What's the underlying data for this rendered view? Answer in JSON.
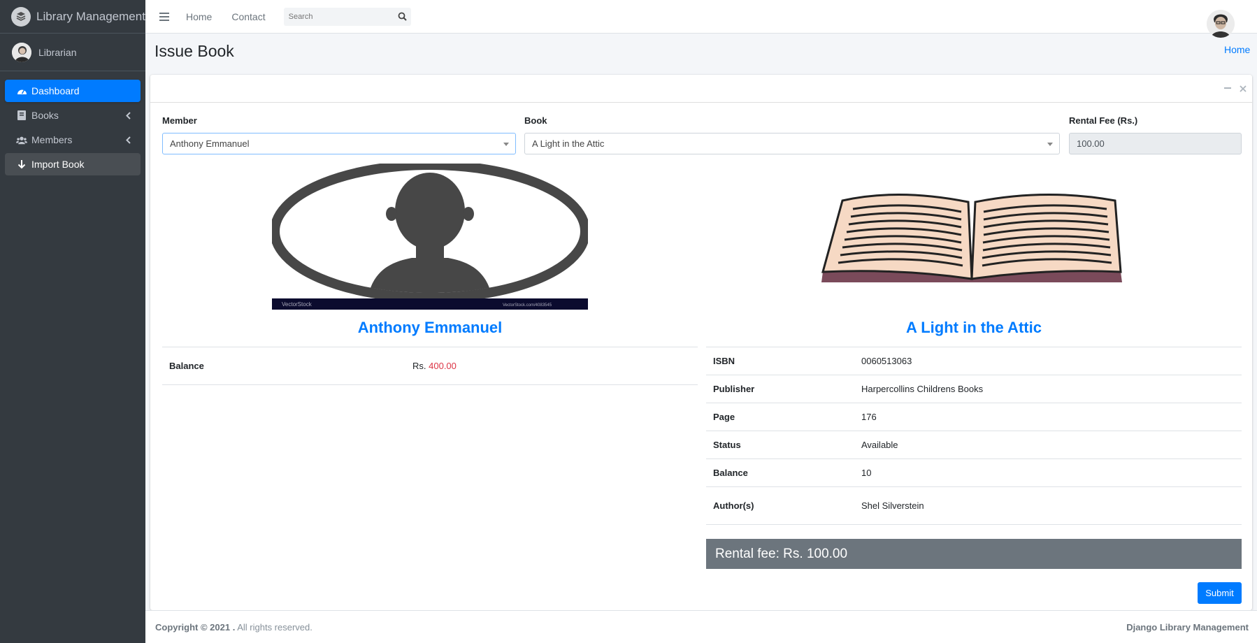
{
  "app": {
    "brand": "Library Management",
    "user": "Librarian"
  },
  "sidebar": {
    "items": [
      {
        "label": "Dashboard",
        "icon": "tachometer-icon"
      },
      {
        "label": "Books",
        "icon": "book-icon"
      },
      {
        "label": "Members",
        "icon": "users-icon"
      },
      {
        "label": "Import Book",
        "icon": "arrow-down-icon"
      }
    ]
  },
  "topbar": {
    "links": [
      "Home",
      "Contact"
    ],
    "search_placeholder": "Search"
  },
  "page": {
    "title": "Issue Book",
    "breadcrumb": "Home"
  },
  "form": {
    "member_label": "Member",
    "member_value": "Anthony Emmanuel",
    "book_label": "Book",
    "book_value": "A Light in the Attic",
    "fee_label": "Rental Fee (Rs.)",
    "fee_value": "100.00"
  },
  "member": {
    "name": "Anthony Emmanuel",
    "balance_label": "Balance",
    "balance_prefix": "Rs.",
    "balance_value": "400.00",
    "image_watermark": "VectorStock",
    "image_watermark_url": "VectorStock.com/4083545"
  },
  "book": {
    "title": "A Light in the Attic",
    "rows": [
      {
        "k": "ISBN",
        "v": "0060513063"
      },
      {
        "k": "Publisher",
        "v": "Harpercollins Childrens Books"
      },
      {
        "k": "Page",
        "v": "176"
      },
      {
        "k": "Status",
        "v": "Available"
      },
      {
        "k": "Balance",
        "v": "10"
      },
      {
        "k": "Author(s)",
        "v": "Shel Silverstein"
      }
    ]
  },
  "rental_fee_text": "Rental fee: Rs. 100.00",
  "submit_label": "Submit",
  "footer": {
    "copyright": "Copyright © 2021 .",
    "rights": " All rights reserved.",
    "right_text": "Django Library Management"
  },
  "colors": {
    "primary": "#007bff",
    "sidebar": "#343a40",
    "danger": "#dc3545",
    "secondary": "#6c757d"
  }
}
